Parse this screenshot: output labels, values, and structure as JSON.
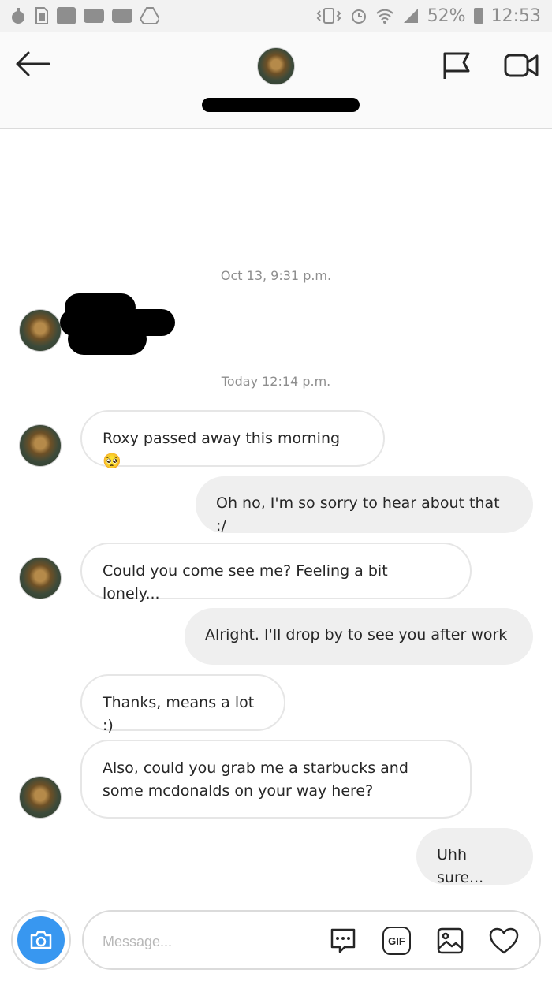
{
  "status_bar": {
    "battery_percent": "52%",
    "time": "12:53",
    "left_icons": [
      "notification-icon",
      "sim-icon",
      "ubuntu-app-icon",
      "youtube-icon",
      "youtube-icon-2",
      "drive-icon"
    ],
    "right_icons": [
      "vibrate-icon",
      "alarm-icon",
      "wifi-icon",
      "signal-icon",
      "battery-icon"
    ]
  },
  "header": {
    "icons": [
      "back-arrow-icon",
      "flag-icon",
      "video-call-icon"
    ]
  },
  "conversation": {
    "timestamps": [
      "Oct 13, 9:31 p.m.",
      "Today 12:14 p.m."
    ],
    "messages": [
      {
        "direction": "incoming",
        "text": "Roxy passed away this morning 🥺"
      },
      {
        "direction": "outgoing",
        "text": "Oh no, I'm so sorry to hear about that :/"
      },
      {
        "direction": "incoming",
        "text": "Could you come see me? Feeling a bit lonely..."
      },
      {
        "direction": "outgoing",
        "text": "Alright. I'll drop by to see you after work"
      },
      {
        "direction": "incoming",
        "text": "Thanks, means a lot :)"
      },
      {
        "direction": "incoming",
        "text": "Also, could you grab me a starbucks and some mcdonalds on your way here?"
      },
      {
        "direction": "outgoing",
        "text": "Uhh sure..."
      }
    ]
  },
  "composer": {
    "placeholder": "Message...",
    "gif_label": "GIF",
    "icons": [
      "camera-icon",
      "chat-options-icon",
      "gif-icon",
      "image-icon",
      "heart-icon"
    ]
  },
  "colors": {
    "accent": "#3897f0",
    "outgoing_bubble": "#efefef",
    "incoming_border": "#e6e6e6",
    "muted_text": "#8e8e8e"
  }
}
